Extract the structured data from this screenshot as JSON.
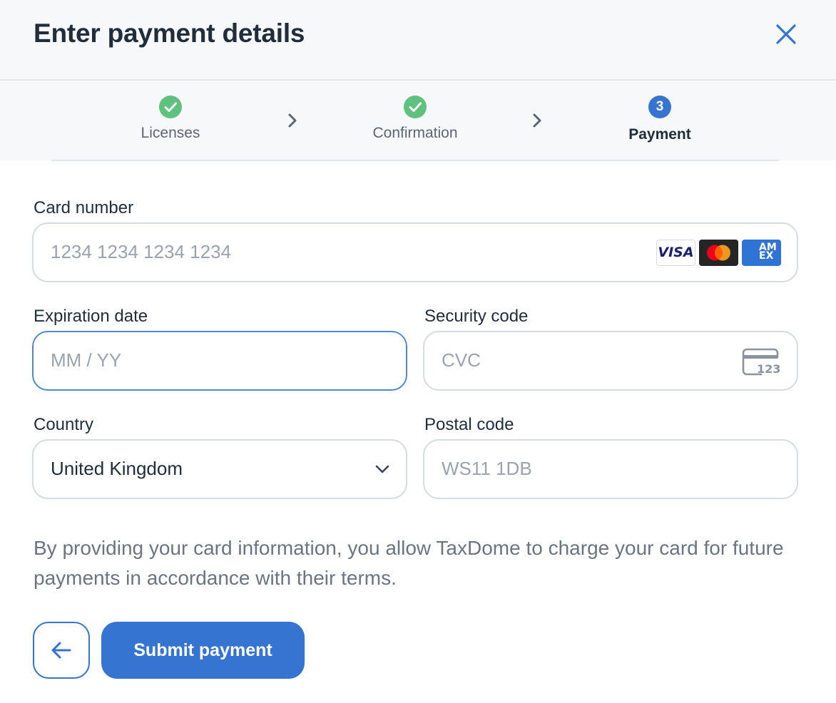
{
  "dialog": {
    "title": "Enter payment details",
    "close_icon": "close-icon"
  },
  "stepper": {
    "steps": [
      {
        "label": "Licenses",
        "status": "done",
        "icon": "check-circle-icon"
      },
      {
        "label": "Confirmation",
        "status": "done",
        "icon": "check-circle-icon"
      },
      {
        "label": "Payment",
        "status": "active",
        "number": "3"
      }
    ],
    "separator_icon": "chevron-right-icon"
  },
  "form": {
    "card_number": {
      "label": "Card number",
      "placeholder": "1234 1234 1234 1234",
      "brands": [
        {
          "name": "VISA",
          "icon": "visa-icon"
        },
        {
          "name": "Mastercard",
          "icon": "mastercard-icon"
        },
        {
          "name": "AMEX",
          "icon": "amex-icon"
        }
      ]
    },
    "expiration": {
      "label": "Expiration date",
      "placeholder": "MM / YY"
    },
    "security_code": {
      "label": "Security code",
      "placeholder": "CVC",
      "icon_text": "123",
      "icon": "cvc-card-icon"
    },
    "country": {
      "label": "Country",
      "value": "United Kingdom",
      "icon": "chevron-down-icon"
    },
    "postal_code": {
      "label": "Postal code",
      "placeholder": "WS11 1DB"
    }
  },
  "notice": "By providing your card information, you allow TaxDome to charge your card for future payments in accordance with their terms.",
  "actions": {
    "back_icon": "arrow-left-icon",
    "submit_label": "Submit payment"
  },
  "colors": {
    "accent": "#3674d1",
    "success": "#5ec27e",
    "header_bg": "#f7f8fa",
    "border": "#d6dbe1"
  }
}
